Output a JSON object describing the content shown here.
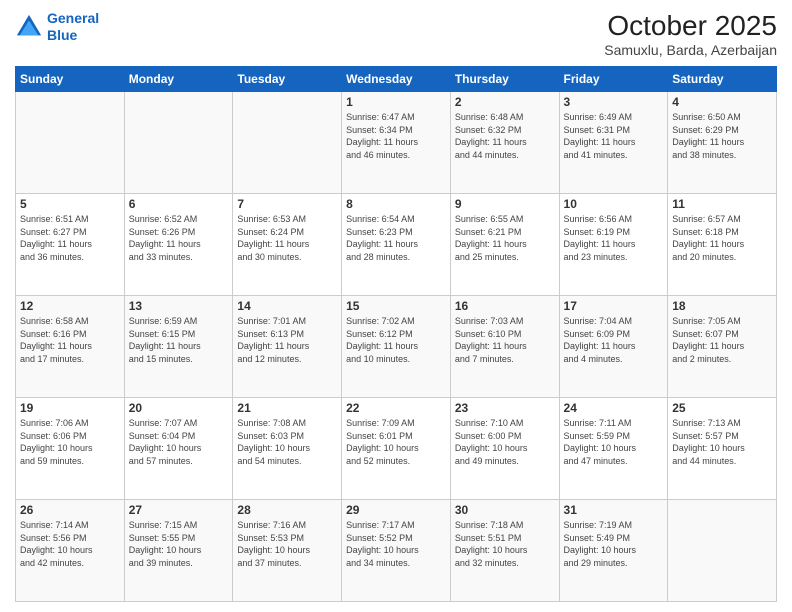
{
  "header": {
    "logo_line1": "General",
    "logo_line2": "Blue",
    "title": "October 2025",
    "subtitle": "Samuxlu, Barda, Azerbaijan"
  },
  "days_of_week": [
    "Sunday",
    "Monday",
    "Tuesday",
    "Wednesday",
    "Thursday",
    "Friday",
    "Saturday"
  ],
  "weeks": [
    [
      {
        "day": "",
        "info": ""
      },
      {
        "day": "",
        "info": ""
      },
      {
        "day": "",
        "info": ""
      },
      {
        "day": "1",
        "info": "Sunrise: 6:47 AM\nSunset: 6:34 PM\nDaylight: 11 hours\nand 46 minutes."
      },
      {
        "day": "2",
        "info": "Sunrise: 6:48 AM\nSunset: 6:32 PM\nDaylight: 11 hours\nand 44 minutes."
      },
      {
        "day": "3",
        "info": "Sunrise: 6:49 AM\nSunset: 6:31 PM\nDaylight: 11 hours\nand 41 minutes."
      },
      {
        "day": "4",
        "info": "Sunrise: 6:50 AM\nSunset: 6:29 PM\nDaylight: 11 hours\nand 38 minutes."
      }
    ],
    [
      {
        "day": "5",
        "info": "Sunrise: 6:51 AM\nSunset: 6:27 PM\nDaylight: 11 hours\nand 36 minutes."
      },
      {
        "day": "6",
        "info": "Sunrise: 6:52 AM\nSunset: 6:26 PM\nDaylight: 11 hours\nand 33 minutes."
      },
      {
        "day": "7",
        "info": "Sunrise: 6:53 AM\nSunset: 6:24 PM\nDaylight: 11 hours\nand 30 minutes."
      },
      {
        "day": "8",
        "info": "Sunrise: 6:54 AM\nSunset: 6:23 PM\nDaylight: 11 hours\nand 28 minutes."
      },
      {
        "day": "9",
        "info": "Sunrise: 6:55 AM\nSunset: 6:21 PM\nDaylight: 11 hours\nand 25 minutes."
      },
      {
        "day": "10",
        "info": "Sunrise: 6:56 AM\nSunset: 6:19 PM\nDaylight: 11 hours\nand 23 minutes."
      },
      {
        "day": "11",
        "info": "Sunrise: 6:57 AM\nSunset: 6:18 PM\nDaylight: 11 hours\nand 20 minutes."
      }
    ],
    [
      {
        "day": "12",
        "info": "Sunrise: 6:58 AM\nSunset: 6:16 PM\nDaylight: 11 hours\nand 17 minutes."
      },
      {
        "day": "13",
        "info": "Sunrise: 6:59 AM\nSunset: 6:15 PM\nDaylight: 11 hours\nand 15 minutes."
      },
      {
        "day": "14",
        "info": "Sunrise: 7:01 AM\nSunset: 6:13 PM\nDaylight: 11 hours\nand 12 minutes."
      },
      {
        "day": "15",
        "info": "Sunrise: 7:02 AM\nSunset: 6:12 PM\nDaylight: 11 hours\nand 10 minutes."
      },
      {
        "day": "16",
        "info": "Sunrise: 7:03 AM\nSunset: 6:10 PM\nDaylight: 11 hours\nand 7 minutes."
      },
      {
        "day": "17",
        "info": "Sunrise: 7:04 AM\nSunset: 6:09 PM\nDaylight: 11 hours\nand 4 minutes."
      },
      {
        "day": "18",
        "info": "Sunrise: 7:05 AM\nSunset: 6:07 PM\nDaylight: 11 hours\nand 2 minutes."
      }
    ],
    [
      {
        "day": "19",
        "info": "Sunrise: 7:06 AM\nSunset: 6:06 PM\nDaylight: 10 hours\nand 59 minutes."
      },
      {
        "day": "20",
        "info": "Sunrise: 7:07 AM\nSunset: 6:04 PM\nDaylight: 10 hours\nand 57 minutes."
      },
      {
        "day": "21",
        "info": "Sunrise: 7:08 AM\nSunset: 6:03 PM\nDaylight: 10 hours\nand 54 minutes."
      },
      {
        "day": "22",
        "info": "Sunrise: 7:09 AM\nSunset: 6:01 PM\nDaylight: 10 hours\nand 52 minutes."
      },
      {
        "day": "23",
        "info": "Sunrise: 7:10 AM\nSunset: 6:00 PM\nDaylight: 10 hours\nand 49 minutes."
      },
      {
        "day": "24",
        "info": "Sunrise: 7:11 AM\nSunset: 5:59 PM\nDaylight: 10 hours\nand 47 minutes."
      },
      {
        "day": "25",
        "info": "Sunrise: 7:13 AM\nSunset: 5:57 PM\nDaylight: 10 hours\nand 44 minutes."
      }
    ],
    [
      {
        "day": "26",
        "info": "Sunrise: 7:14 AM\nSunset: 5:56 PM\nDaylight: 10 hours\nand 42 minutes."
      },
      {
        "day": "27",
        "info": "Sunrise: 7:15 AM\nSunset: 5:55 PM\nDaylight: 10 hours\nand 39 minutes."
      },
      {
        "day": "28",
        "info": "Sunrise: 7:16 AM\nSunset: 5:53 PM\nDaylight: 10 hours\nand 37 minutes."
      },
      {
        "day": "29",
        "info": "Sunrise: 7:17 AM\nSunset: 5:52 PM\nDaylight: 10 hours\nand 34 minutes."
      },
      {
        "day": "30",
        "info": "Sunrise: 7:18 AM\nSunset: 5:51 PM\nDaylight: 10 hours\nand 32 minutes."
      },
      {
        "day": "31",
        "info": "Sunrise: 7:19 AM\nSunset: 5:49 PM\nDaylight: 10 hours\nand 29 minutes."
      },
      {
        "day": "",
        "info": ""
      }
    ]
  ]
}
